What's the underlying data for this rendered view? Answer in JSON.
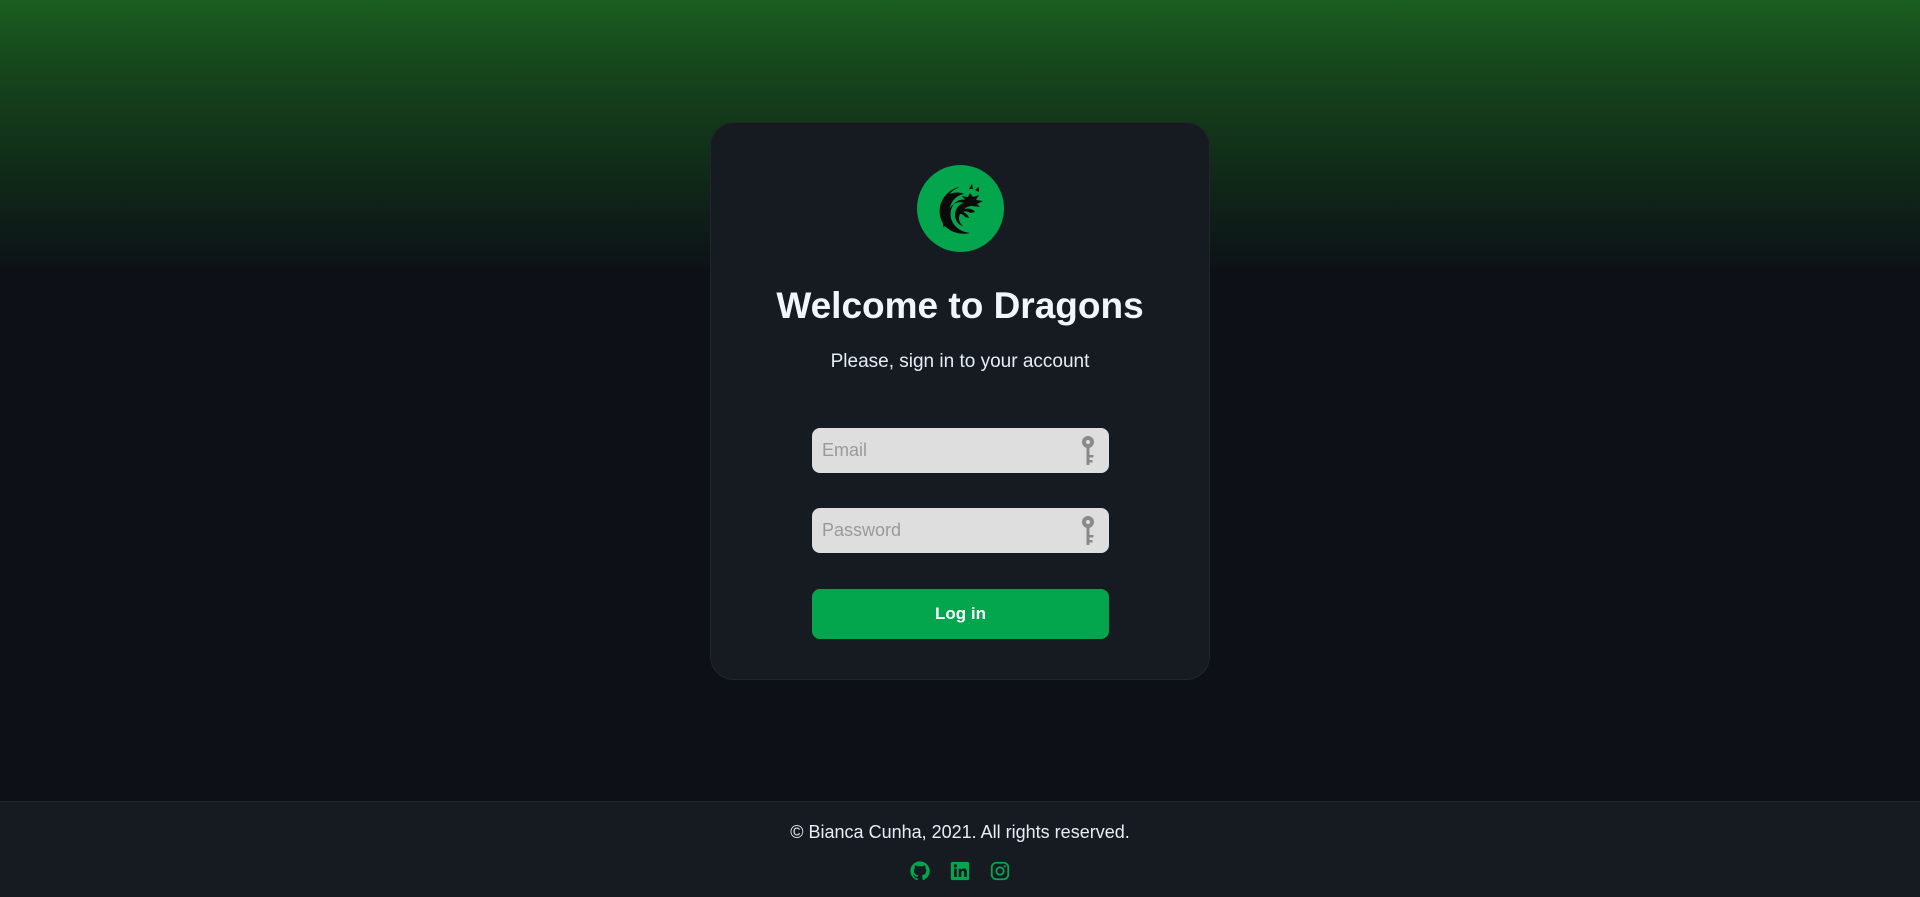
{
  "login": {
    "title": "Welcome to Dragons",
    "subtitle": "Please, sign in to your account",
    "email_placeholder": "Email",
    "password_placeholder": "Password",
    "submit_label": "Log in",
    "logo_icon": "dragon-icon",
    "field_icon": "key-icon"
  },
  "footer": {
    "copyright": "© Bianca Cunha, 2021. All rights reserved.",
    "socials": [
      "github-icon",
      "linkedin-icon",
      "instagram-icon"
    ]
  },
  "colors": {
    "accent": "#03a64d",
    "background": "#0d1117",
    "card": "#161b22",
    "gradient_top": "#1b5e20",
    "input_bg": "#dedede"
  }
}
